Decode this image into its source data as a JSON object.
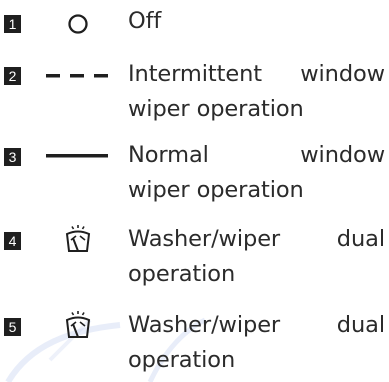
{
  "items": [
    {
      "number": "1",
      "symbol": "off-circle-icon",
      "text_line1": "Off",
      "text_line2": ""
    },
    {
      "number": "2",
      "symbol": "dashed-line-icon",
      "text_line1": "Intermittent window",
      "text_line2": "wiper operation"
    },
    {
      "number": "3",
      "symbol": "solid-line-icon",
      "text_line1": "Normal window",
      "text_line2": "wiper operation"
    },
    {
      "number": "4",
      "symbol": "washer-wiper-icon",
      "text_line1": "Washer/wiper dual",
      "text_line2": "operation"
    },
    {
      "number": "5",
      "symbol": "washer-wiper-icon",
      "text_line1": "Washer/wiper dual",
      "text_line2": "operation"
    }
  ],
  "colors": {
    "text": "#2b2b2b",
    "badge": "#1f1f1f",
    "watermark": "#c9d5f0"
  }
}
